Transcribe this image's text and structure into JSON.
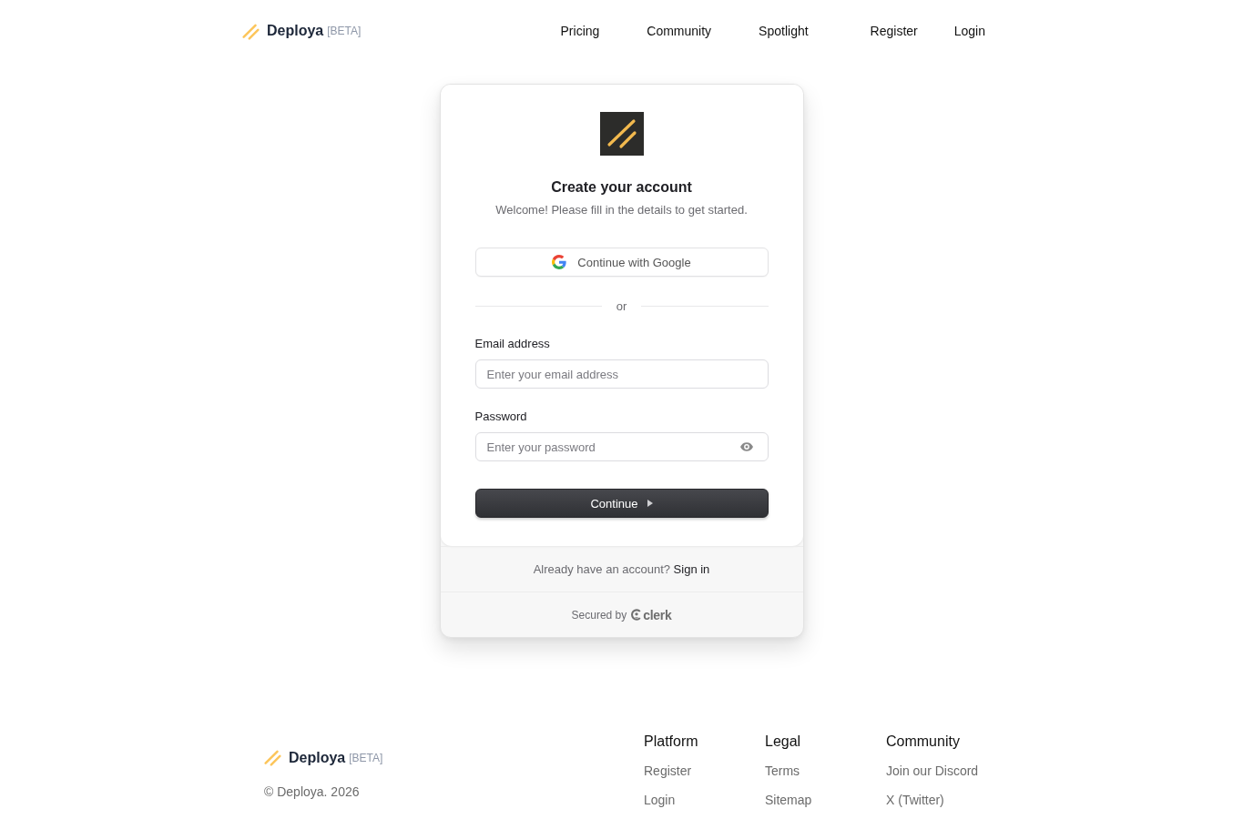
{
  "header": {
    "brand": "Deploya",
    "badge": "[BETA]",
    "nav": [
      "Pricing",
      "Community",
      "Spotlight"
    ],
    "auth_links": [
      "Register",
      "Login"
    ]
  },
  "card": {
    "title": "Create your account",
    "subtitle": "Welcome! Please fill in the details to get started.",
    "social_button": "Continue with Google",
    "divider": "or",
    "fields": [
      {
        "kind": "email",
        "label": "Email address",
        "placeholder": "Enter your email address"
      },
      {
        "kind": "password",
        "label": "Password",
        "placeholder": "Enter your password"
      }
    ],
    "submit": "Continue",
    "footer_prompt": "Already have an account?",
    "footer_link": "Sign in",
    "secured_by": "Secured by",
    "provider": "clerk"
  },
  "footer": {
    "brand": "Deploya",
    "badge": "[BETA]",
    "copyright": "© Deploya. 2026",
    "columns": [
      {
        "heading": "Platform",
        "links": [
          "Register",
          "Login"
        ]
      },
      {
        "heading": "Legal",
        "links": [
          "Terms",
          "Sitemap"
        ]
      },
      {
        "heading": "Community",
        "links": [
          "Join our Discord",
          "X (Twitter)"
        ]
      }
    ]
  }
}
